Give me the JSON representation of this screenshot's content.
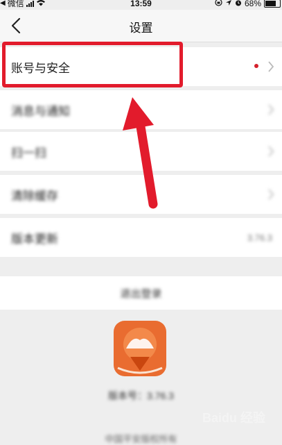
{
  "status_bar": {
    "carrier": "微信",
    "time": "13:59",
    "battery": "68%"
  },
  "nav": {
    "title": "设置",
    "back_icon": "chevron-left-icon"
  },
  "menu": {
    "items": [
      {
        "label": "账号与安全",
        "has_dot": true
      },
      {
        "label": "消息与通知"
      },
      {
        "label": "扫一扫"
      },
      {
        "label": "清除缓存"
      },
      {
        "label": "版本更新",
        "value": "3.76.3"
      }
    ]
  },
  "logout_label": "退出登录",
  "version_text": "版本号：3.76.3",
  "copyright": "中国平安版权所有",
  "watermark": "Baidu 经验",
  "colors": {
    "highlight": "#e21b2c",
    "logo": "#e8611f",
    "dot": "#d4202c"
  }
}
